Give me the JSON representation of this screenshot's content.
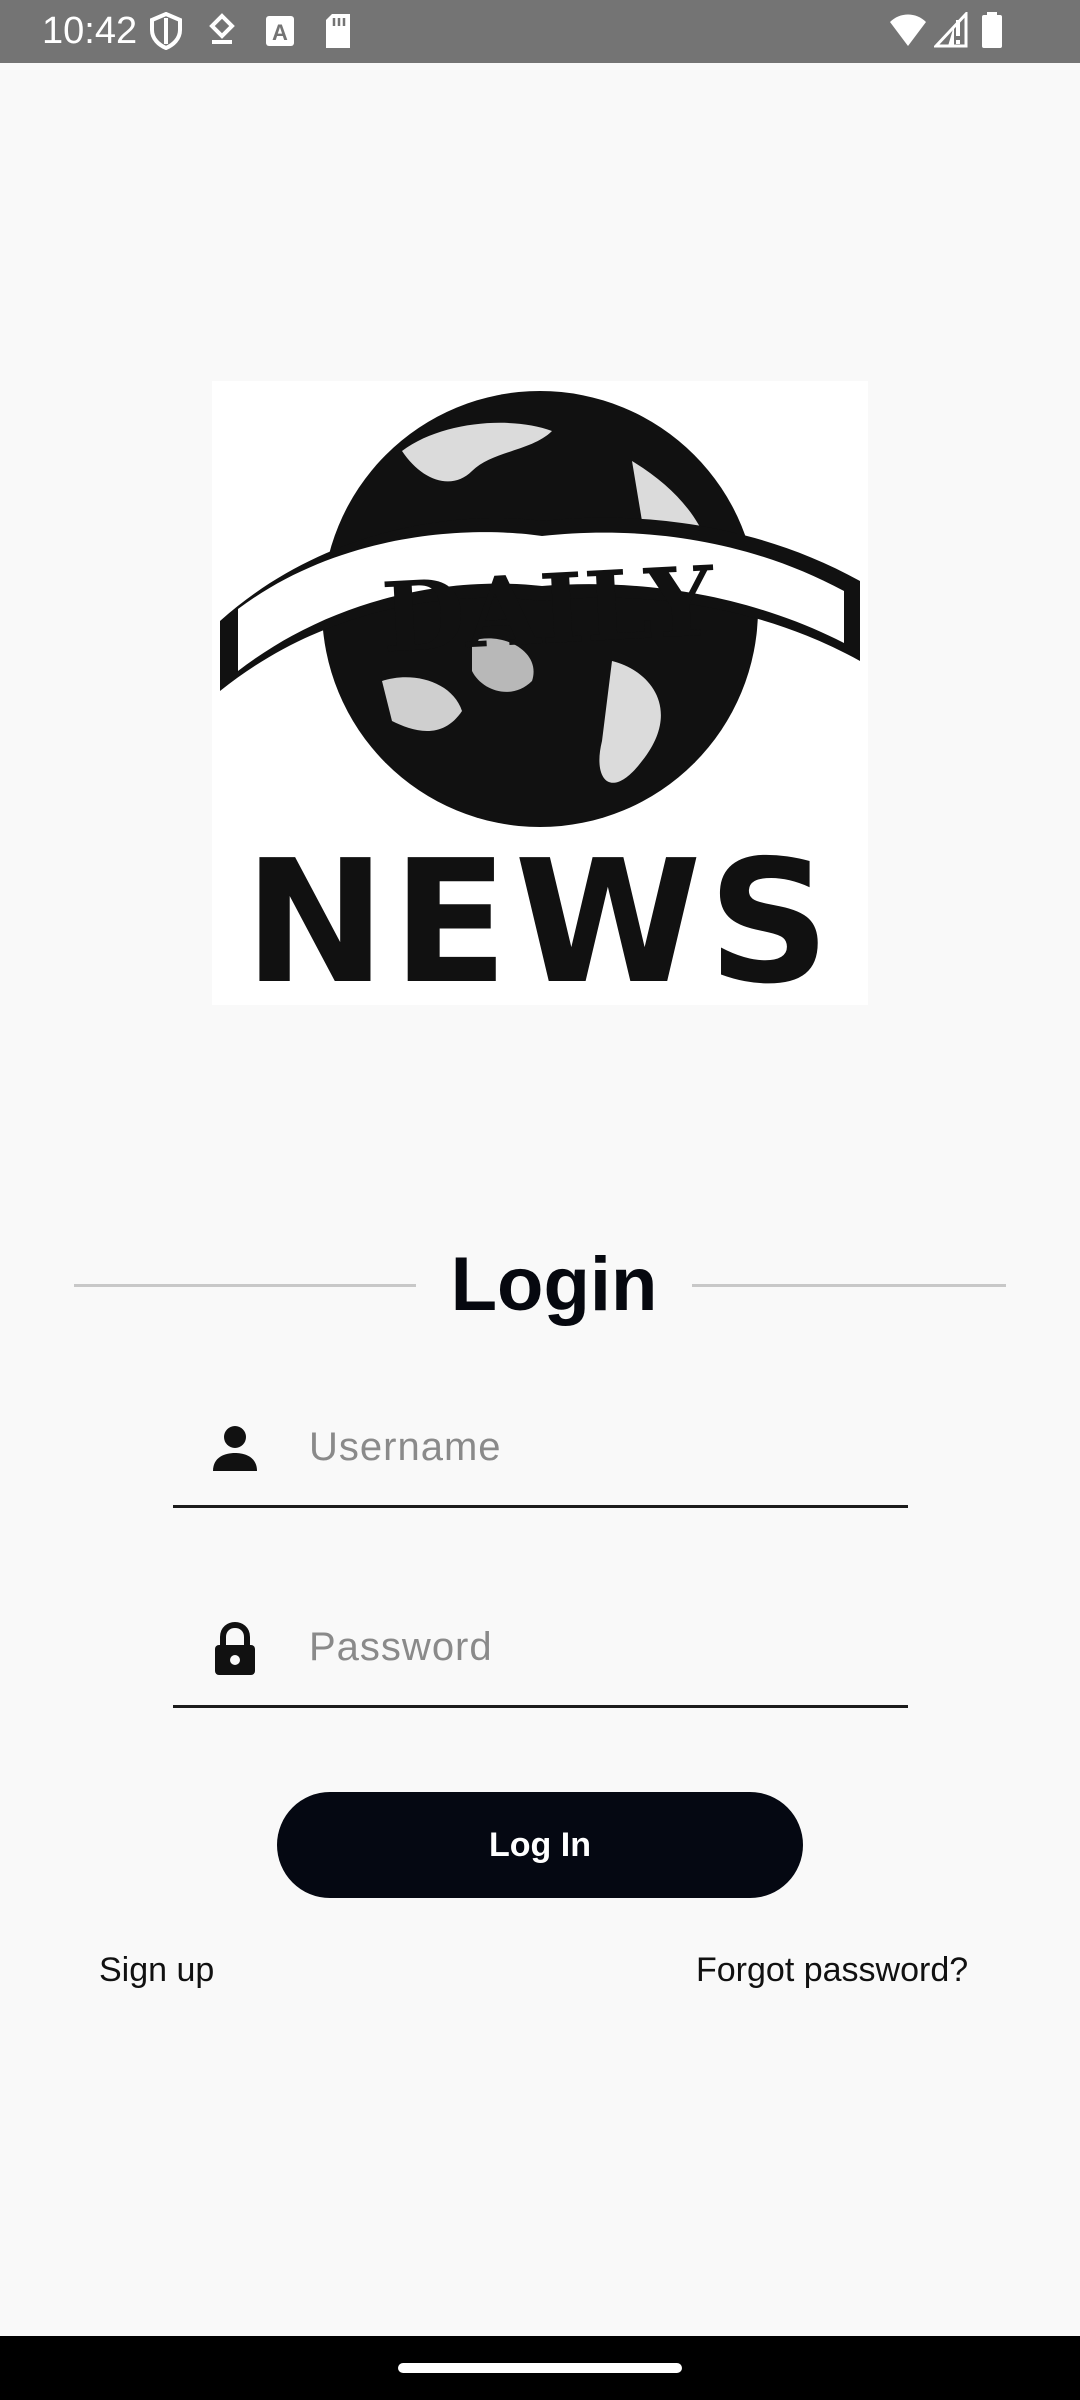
{
  "status_bar": {
    "time": "10:42",
    "icons": [
      "shield-icon",
      "download-icon",
      "a-badge-icon",
      "sd-card-icon",
      "wifi-icon",
      "signal-icon",
      "battery-icon"
    ]
  },
  "logo": {
    "top_word": "DAILY",
    "bottom_word": "NEWS"
  },
  "login": {
    "title": "Login",
    "username_placeholder": "Username",
    "username_value": "",
    "password_placeholder": "Password",
    "password_value": "",
    "button_label": "Log In"
  },
  "links": {
    "sign_up": "Sign up",
    "forgot_password": "Forgot password?"
  },
  "colors": {
    "background": "#f9f9f9",
    "button": "#050812",
    "status_bar": "#747474"
  }
}
